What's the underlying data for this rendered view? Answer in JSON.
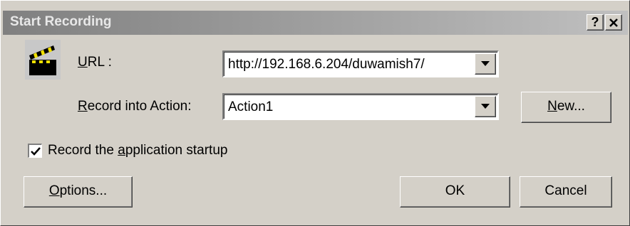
{
  "dialog": {
    "title": "Start Recording",
    "help_button": "?",
    "close_button": "✕"
  },
  "url_field": {
    "label_prefix": "",
    "label_mnemonic": "U",
    "label_rest": "RL :",
    "value": "http://192.168.6.204/duwamish7/"
  },
  "action_field": {
    "label_mnemonic": "R",
    "label_rest": "ecord into Action:",
    "value": "Action1"
  },
  "new_button": {
    "mnemonic": "N",
    "rest": "ew..."
  },
  "startup_checkbox": {
    "checked": true,
    "label_before": "Record the ",
    "label_mnemonic": "a",
    "label_after": "pplication startup"
  },
  "options_button": {
    "mnemonic": "O",
    "rest": "ptions..."
  },
  "ok_button": {
    "label": "OK"
  },
  "cancel_button": {
    "label": "Cancel"
  },
  "icons": {
    "app_icon": "clapperboard-icon",
    "dropdown": "chevron-down-icon",
    "check": "checkmark-icon"
  },
  "colors": {
    "face": "#d4d0c8",
    "title_gradient_start": "#808080",
    "title_gradient_end": "#c0c0c0",
    "title_text": "#e8e8e8"
  }
}
